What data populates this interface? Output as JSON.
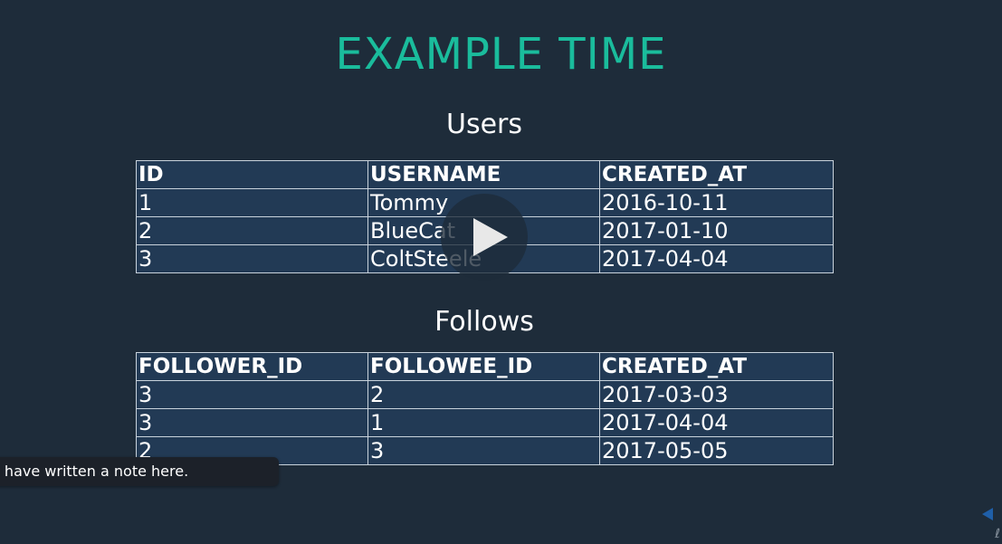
{
  "slide": {
    "title": "EXAMPLE TIME",
    "title_color": "#1abc9c",
    "background_color": "#1e2c3a"
  },
  "users": {
    "heading": "Users",
    "headers": [
      "ID",
      "USERNAME",
      "CREATED_AT"
    ],
    "rows": [
      [
        "1",
        "Tommy",
        "2016-10-11"
      ],
      [
        "2",
        "BlueCat",
        "2017-01-10"
      ],
      [
        "3",
        "ColtSteele",
        "2017-04-04"
      ]
    ]
  },
  "follows": {
    "heading": "Follows",
    "headers": [
      "FOLLOWER_ID",
      "FOLLOWEE_ID",
      "CREATED_AT"
    ],
    "rows": [
      [
        "3",
        "2",
        "2017-03-03"
      ],
      [
        "3",
        "1",
        "2017-04-04"
      ],
      [
        "2",
        "3",
        "2017-05-05"
      ]
    ]
  },
  "player": {
    "play_icon": "play-icon"
  },
  "note": {
    "text": "e have written a note here."
  }
}
